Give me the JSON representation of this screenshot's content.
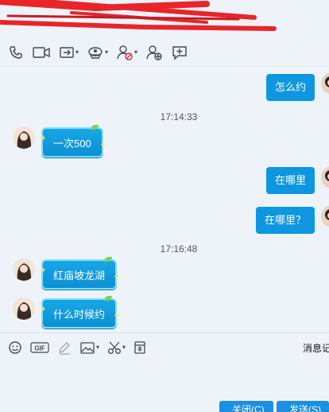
{
  "top_toolbar": {
    "icons": [
      "phone-icon",
      "video-icon",
      "share-screen-icon",
      "remote-assist-icon",
      "block-contact-icon",
      "add-friend-icon",
      "add-app-icon"
    ]
  },
  "messages": [
    {
      "side": "right",
      "text": "怎么约"
    },
    {
      "type": "time",
      "text": "17:14:33"
    },
    {
      "side": "left",
      "text": "一次500"
    },
    {
      "side": "right",
      "text": "在哪里"
    },
    {
      "side": "right",
      "text": "在哪里？"
    },
    {
      "type": "time",
      "text": "17:16:48"
    },
    {
      "side": "left",
      "text": "红庙坡龙湖"
    },
    {
      "side": "left",
      "text": "什么时候约"
    }
  ],
  "input_toolbar": {
    "icons": [
      "emoji-icon",
      "gif-icon",
      "pen-icon",
      "image-icon",
      "scissors-icon",
      "red-packet-icon"
    ],
    "gif_label": "GIF",
    "history_label": "消息记"
  },
  "footer": {
    "close_label": "关闭(C)",
    "send_label": "发送(S)"
  },
  "colors": {
    "accent": "#0c97e0",
    "background": "#eef3f9",
    "button": "#1b8fe3",
    "scribble": "#e8252a"
  }
}
